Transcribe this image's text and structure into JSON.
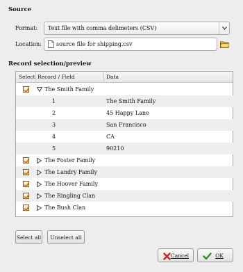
{
  "source": {
    "title": "Source",
    "format_label": "Format:",
    "format_value": "Text file with comma delimeters (CSV)",
    "location_label": "Location:",
    "location_value": "source file for shipping.csv"
  },
  "records": {
    "title": "Record selection/preview",
    "columns": [
      "Select",
      "Record / Field",
      "Data"
    ],
    "rows": [
      {
        "checked": true,
        "expanded": true,
        "label": "The Smith Family"
      },
      {
        "field": "1",
        "data": "The Smith Family"
      },
      {
        "field": "2",
        "data": "45 Happy Lane"
      },
      {
        "field": "3",
        "data": "San Francisco"
      },
      {
        "field": "4",
        "data": "CA"
      },
      {
        "field": "5",
        "data": "90210"
      },
      {
        "checked": true,
        "expanded": false,
        "label": "The Foster Family"
      },
      {
        "checked": true,
        "expanded": false,
        "label": "The Landry Family"
      },
      {
        "checked": true,
        "expanded": false,
        "label": "The Hoover Family"
      },
      {
        "checked": true,
        "expanded": false,
        "label": "The Ringling Clan"
      },
      {
        "checked": true,
        "expanded": false,
        "label": "The Bush Clan"
      }
    ]
  },
  "buttons": {
    "select_all": "Select all",
    "unselect_all": "Unselect all",
    "cancel": "Cancel",
    "ok": "OK"
  },
  "colors": {
    "checkbox_mark": "#e07a10",
    "window_bg": "#ededed",
    "cancel_icon": "#cc2222",
    "ok_icon": "#3a8a2a"
  }
}
